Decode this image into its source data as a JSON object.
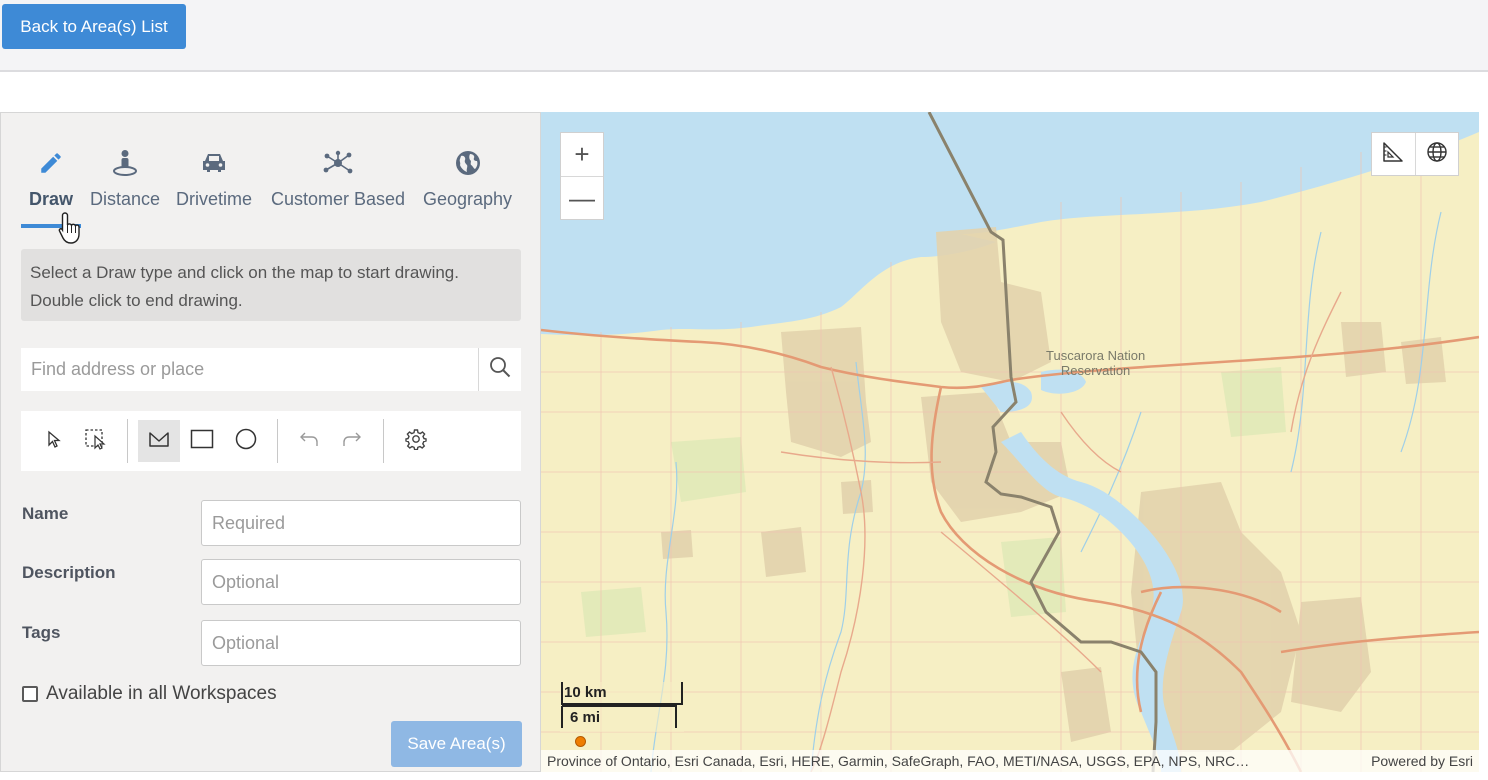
{
  "header": {
    "back_label": "Back to Area(s) List"
  },
  "tabs": [
    {
      "label": "Draw",
      "icon": "pencil-icon",
      "active": true
    },
    {
      "label": "Distance",
      "icon": "person-pin-icon"
    },
    {
      "label": "Drivetime",
      "icon": "car-icon"
    },
    {
      "label": "Customer Based",
      "icon": "network-icon"
    },
    {
      "label": "Geography",
      "icon": "globe-icon"
    }
  ],
  "info": {
    "line1": "Select a Draw type and click on the map to start drawing.",
    "line2": "Double click to end drawing."
  },
  "search": {
    "placeholder": "Find address or place"
  },
  "draw_tools": {
    "items": [
      "pointer-icon",
      "select-box-icon",
      "polygon-icon",
      "rectangle-icon",
      "circle-icon",
      "undo-icon",
      "redo-icon",
      "settings-icon"
    ],
    "selected": "polygon-icon"
  },
  "form": {
    "name_label": "Name",
    "name_placeholder": "Required",
    "description_label": "Description",
    "description_placeholder": "Optional",
    "tags_label": "Tags",
    "tags_placeholder": "Optional",
    "checkbox_label": "Available in all Workspaces",
    "checkbox_checked": false,
    "save_label": "Save Area(s)"
  },
  "map": {
    "zoom_in": "+",
    "zoom_out": "—",
    "scale_km": "10 km",
    "scale_mi": "6 mi",
    "place_line1": "Tuscarora Nation",
    "place_line2": "Reservation",
    "attribution": "Province of Ontario, Esri Canada, Esri, HERE, Garmin, SafeGraph, FAO, METI/NASA, USGS, EPA, NPS, NRC…",
    "powered_by": "Powered by Esri",
    "colors": {
      "water": "#bfe0f2",
      "land": "#f6efc4",
      "urban": "#e3d3ad",
      "highway": "#e49a74",
      "border": "#8a826c"
    }
  }
}
